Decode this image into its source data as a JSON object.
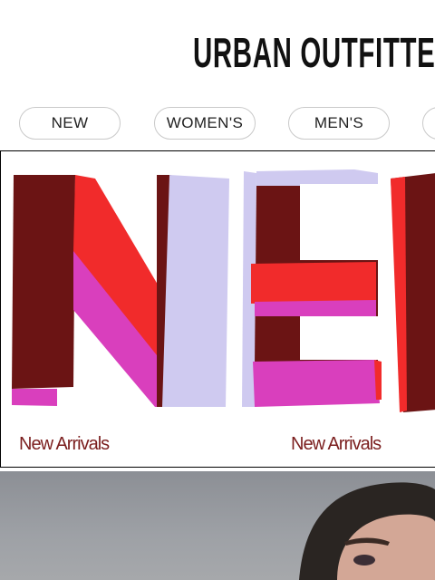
{
  "brand": {
    "logo_text": "URBAN OUTFITTERS"
  },
  "nav": {
    "items": [
      {
        "label": "NEW"
      },
      {
        "label": "WOMEN'S"
      },
      {
        "label": "MEN'S"
      },
      {
        "label": ""
      }
    ]
  },
  "hero": {
    "artwork_text": "NEW",
    "captions": [
      "New Arrivals",
      "New Arrivals"
    ]
  },
  "colors": {
    "caption": "#7b1e1e",
    "paint_brown": "#6b1414",
    "paint_red": "#f12b2b",
    "paint_pink": "#d93fbd",
    "paint_lilac": "#cfcaf0"
  }
}
